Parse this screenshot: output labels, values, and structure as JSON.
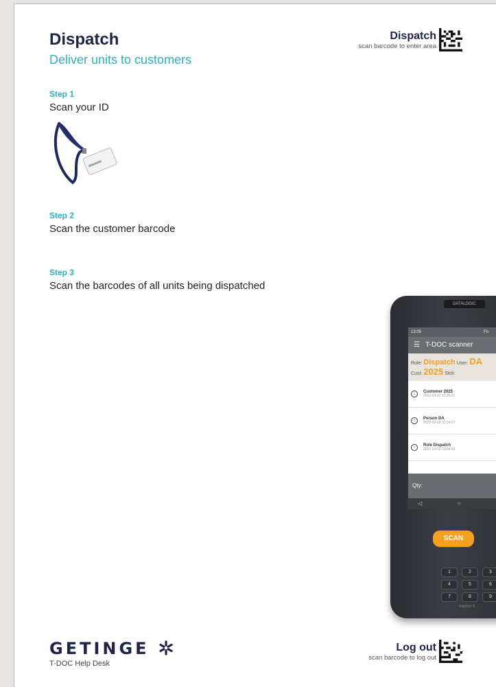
{
  "header": {
    "title": "Dispatch",
    "subtitle": "Deliver units to customers",
    "area_code_label": "Dispatch",
    "area_code_hint": "scan barcode to enter area"
  },
  "steps": [
    {
      "number": "Step 1",
      "text": "Scan your ID"
    },
    {
      "number": "Step 2",
      "text": "Scan the customer barcode"
    },
    {
      "number": "Step 3",
      "text": "Scan the barcodes of all units being dispatched"
    }
  ],
  "scanner": {
    "brand": "DATALOGIC",
    "time": "13:05",
    "fn": "Fn",
    "app_title": "T-DOC scanner",
    "role_label": "Role:",
    "role_value": "Dispatch",
    "user_label": "User:",
    "user_value": "DA",
    "cust_label": "Cust:",
    "cust_value": "2025",
    "stck_label": "Stck:",
    "rows": [
      {
        "title": "Customer 2025",
        "time": "2022-03-02 13:05:01"
      },
      {
        "title": "Person DA",
        "time": "2022-03-02 13:04:57"
      },
      {
        "title": "Role Dispatch",
        "time": "2022-03-02 13:04:53"
      }
    ],
    "qty_label": "Qty:",
    "scan_label": "SCAN",
    "keys": [
      "1",
      "2",
      "3",
      "4",
      "5",
      "6",
      "7",
      "8",
      "9"
    ],
    "model": "memor k"
  },
  "footer": {
    "brand": "GETINGE",
    "brand_sub": "T-DOC Help Desk",
    "logout_label": "Log out",
    "logout_hint": "scan barcode to log out"
  },
  "colors": {
    "navy": "#1d2446",
    "teal": "#2eb1bd",
    "orange": "#f2a01e"
  }
}
